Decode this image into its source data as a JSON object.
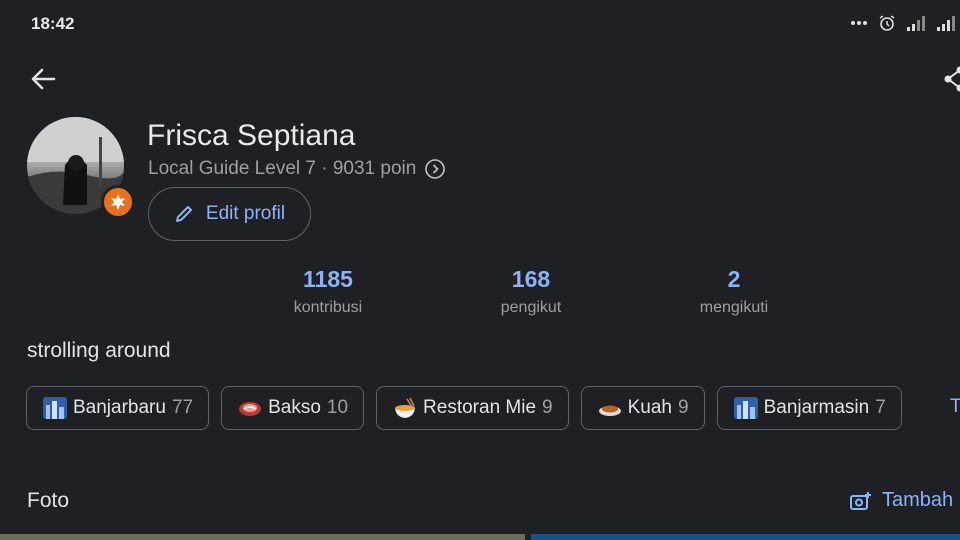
{
  "status_bar": {
    "time": "18:42"
  },
  "profile": {
    "name": "Frisca Septiana",
    "level": "Local Guide Level 7 · 9031 poin",
    "edit_label": "Edit profil",
    "bio": "strolling around"
  },
  "stats": [
    {
      "value": "1185",
      "label": "kontribusi"
    },
    {
      "value": "168",
      "label": "pengikut"
    },
    {
      "value": "2",
      "label": "mengikuti"
    }
  ],
  "chips": [
    {
      "icon": "city-emoji-icon",
      "label": "Banjarbaru",
      "count": "77"
    },
    {
      "icon": "meat-emoji-icon",
      "label": "Bakso",
      "count": "10"
    },
    {
      "icon": "noodle-emoji-icon",
      "label": "Restoran Mie",
      "count": "9"
    },
    {
      "icon": "bowl-emoji-icon",
      "label": "Kuah",
      "count": "9"
    },
    {
      "icon": "city-emoji-icon",
      "label": "Banjarmasin",
      "count": "7"
    }
  ],
  "chip_more_partial": "T",
  "photos_section": {
    "title": "Foto",
    "add_label": "Tambah"
  },
  "colors": {
    "background": "#1f2023",
    "accent": "#8ab4f8",
    "badge": "#e8711c"
  }
}
